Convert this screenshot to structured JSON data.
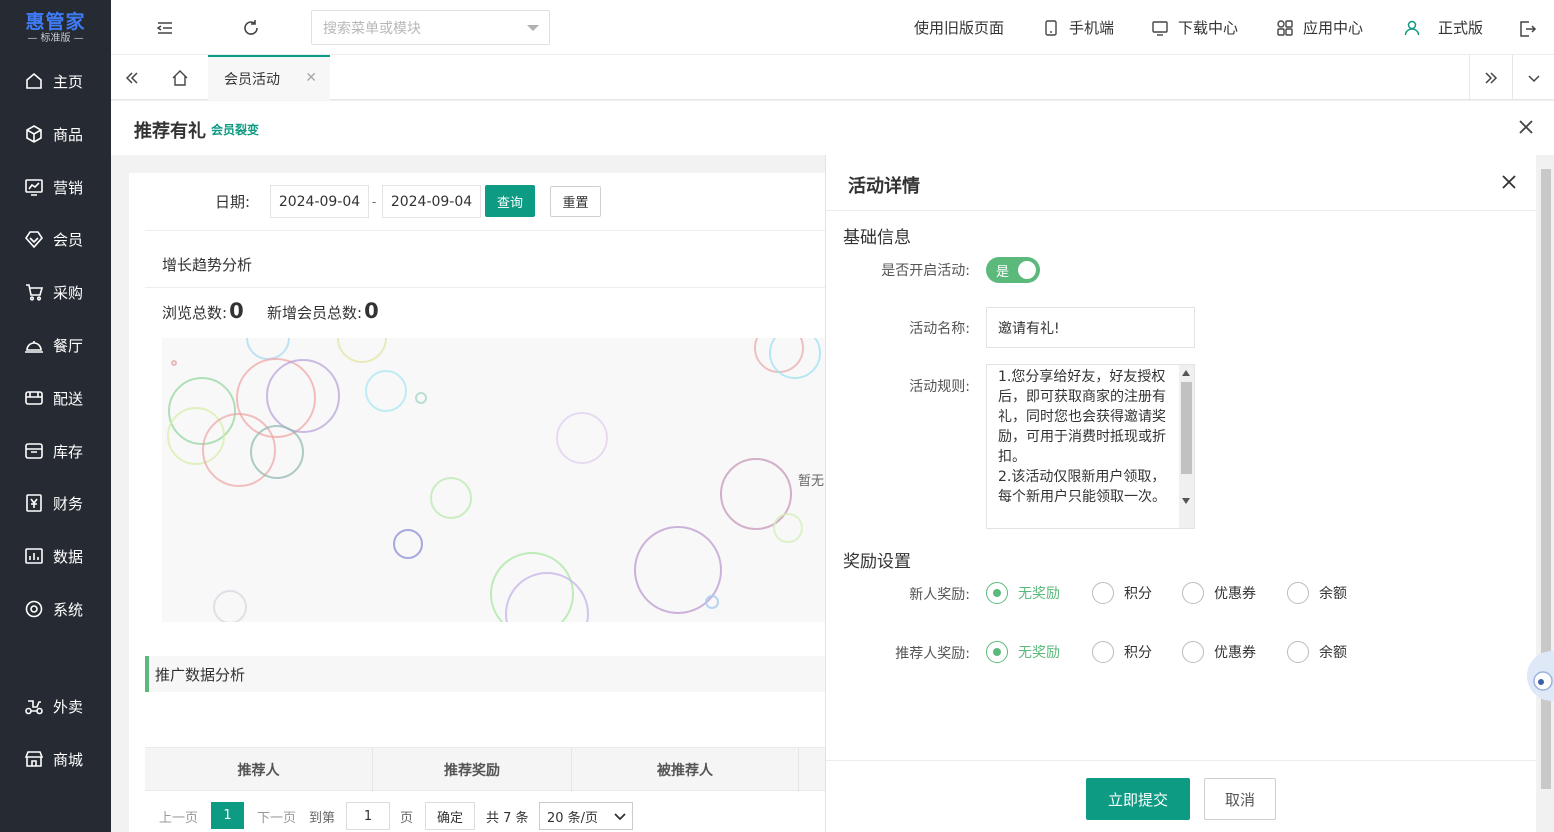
{
  "app": {
    "logo_main": "惠管家",
    "logo_sub": "— 标准版 —"
  },
  "sidebar": {
    "items": [
      {
        "label": "主页",
        "icon": "home-icon"
      },
      {
        "label": "商品",
        "icon": "cube-icon"
      },
      {
        "label": "营销",
        "icon": "chart-screen-icon"
      },
      {
        "label": "会员",
        "icon": "diamond-icon"
      },
      {
        "label": "采购",
        "icon": "cart-icon"
      },
      {
        "label": "餐厅",
        "icon": "cloche-icon"
      },
      {
        "label": "配送",
        "icon": "truck-icon"
      },
      {
        "label": "库存",
        "icon": "box-icon"
      },
      {
        "label": "财务",
        "icon": "yen-icon"
      },
      {
        "label": "数据",
        "icon": "bar-chart-icon"
      },
      {
        "label": "系统",
        "icon": "target-icon"
      },
      {
        "label": "外卖",
        "icon": "scooter-icon"
      },
      {
        "label": "商城",
        "icon": "shop-icon"
      }
    ]
  },
  "topbar": {
    "search_placeholder": "搜索菜单或模块",
    "links": {
      "old_page": "使用旧版页面",
      "mobile": "手机端",
      "download": "下载中心",
      "apps": "应用中心",
      "version": "正式版"
    }
  },
  "tabs": {
    "active": "会员活动"
  },
  "page": {
    "title": "推荐有礼",
    "tag": "会员裂变"
  },
  "filter": {
    "date_label": "日期:",
    "start": "2024-09-04",
    "end": "2024-09-04",
    "sep": "-",
    "query": "查询",
    "reset": "重置"
  },
  "trend": {
    "title": "增长趋势分析",
    "views_label": "浏览总数:",
    "views": "0",
    "new_members_label": "新增会员总数:",
    "new_members": "0",
    "no_data": "暂无"
  },
  "promo": {
    "title": "推广数据分析",
    "columns": [
      "推荐人",
      "推荐奖励",
      "被推荐人"
    ]
  },
  "pager": {
    "prev": "上一页",
    "current": "1",
    "next": "下一页",
    "goto": "到第",
    "goto_value": "1",
    "page_unit": "页",
    "confirm": "确定",
    "total": "共 7 条",
    "size": "20 条/页"
  },
  "drawer": {
    "title": "活动详情",
    "basic_title": "基础信息",
    "enable_label": "是否开启活动:",
    "enable_value": "是",
    "name_label": "活动名称:",
    "name_value": "邀请有礼!",
    "rules_label": "活动规则:",
    "rules_value": "1.您分享给好友，好友授权后，即可获取商家的注册有礼，同时您也会获得邀请奖励，可用于消费时抵现或折扣。\n2.该活动仅限新用户领取，每个新用户只能领取一次。",
    "reward_title": "奖励设置",
    "new_reward_label": "新人奖励:",
    "ref_reward_label": "推荐人奖励:",
    "reward_options": [
      "无奖励",
      "积分",
      "优惠券",
      "余额"
    ],
    "new_reward_selected": "无奖励",
    "ref_reward_selected": "无奖励",
    "submit": "立即提交",
    "cancel": "取消"
  },
  "colors": {
    "accent": "#0e9b83",
    "toggle": "#5bb97b",
    "sidebar_bg": "#262b33",
    "logo": "#3f7bf6"
  }
}
